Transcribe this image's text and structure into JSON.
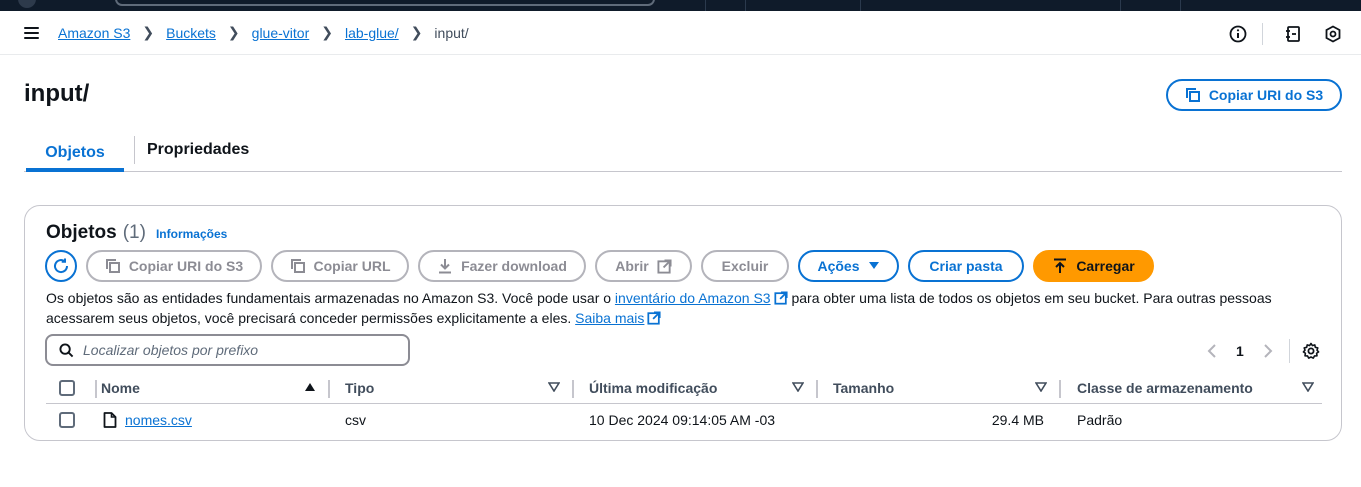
{
  "breadcrumb": [
    "Amazon S3",
    "Buckets",
    "glue-vitor",
    "lab-glue/",
    "input/"
  ],
  "page": {
    "title": "input/",
    "copy_uri_label": "Copiar URI do S3"
  },
  "tabs": [
    {
      "label": "Objetos",
      "active": true
    },
    {
      "label": "Propriedades",
      "active": false
    }
  ],
  "panel": {
    "title": "Objetos",
    "count": "(1)",
    "info_link": "Informações",
    "buttons": {
      "copy_uri": "Copiar URI do S3",
      "copy_url": "Copiar URL",
      "download": "Fazer download",
      "open": "Abrir",
      "delete": "Excluir",
      "actions": "Ações",
      "create_folder": "Criar pasta",
      "upload": "Carregar"
    },
    "description": {
      "part1": "Os objetos são as entidades fundamentais armazenadas no Amazon S3. Você pode usar o ",
      "link1": "inventário do Amazon S3",
      "part2": " para obter uma lista de todos os objetos em seu bucket. Para outras pessoas acessarem seus objetos, você precisará conceder permissões explicitamente a eles. ",
      "link2": "Saiba mais"
    },
    "search_placeholder": "Localizar objetos por prefixo",
    "page_number": "1"
  },
  "table": {
    "columns": [
      "Nome",
      "Tipo",
      "Última modificação",
      "Tamanho",
      "Classe de armazenamento"
    ],
    "rows": [
      {
        "name": "nomes.csv",
        "type": "csv",
        "modified": "10 Dec 2024 09:14:05 AM -03",
        "size": "29.4 MB",
        "storage_class": "Padrão"
      }
    ]
  },
  "colors": {
    "link": "#0972d3",
    "primary_button": "#ff9900",
    "topbar": "#0f1b2a"
  }
}
